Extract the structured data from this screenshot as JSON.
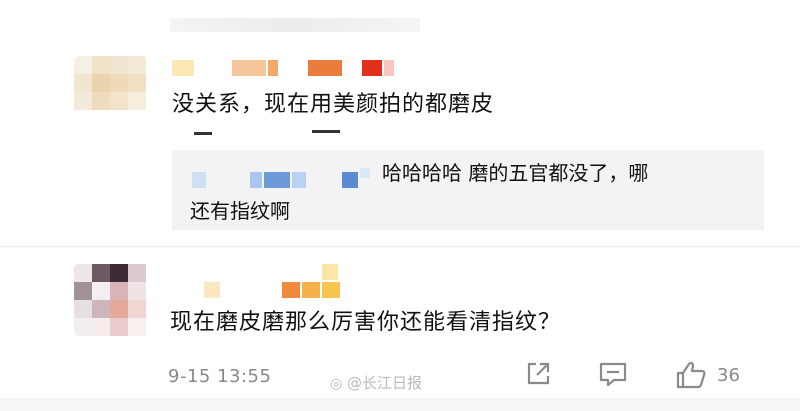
{
  "comment1": {
    "text": "没关系，现在用美颜拍的都磨皮"
  },
  "reply": {
    "line1": "哈哈哈哈 磨的五官都没了，哪",
    "line2": "还有指纹啊"
  },
  "comment2": {
    "text": "现在磨皮磨那么厉害你还能看清指纹？",
    "timestamp": "9-15 13:55",
    "like_count": "36"
  },
  "watermark": {
    "text": "@长江日报"
  },
  "icons": {
    "share": "share-icon",
    "comment": "comment-icon",
    "like": "thumbs-up-icon"
  },
  "colors": {
    "meta_gray": "#888888",
    "reply_bg": "#f3f3f3"
  }
}
